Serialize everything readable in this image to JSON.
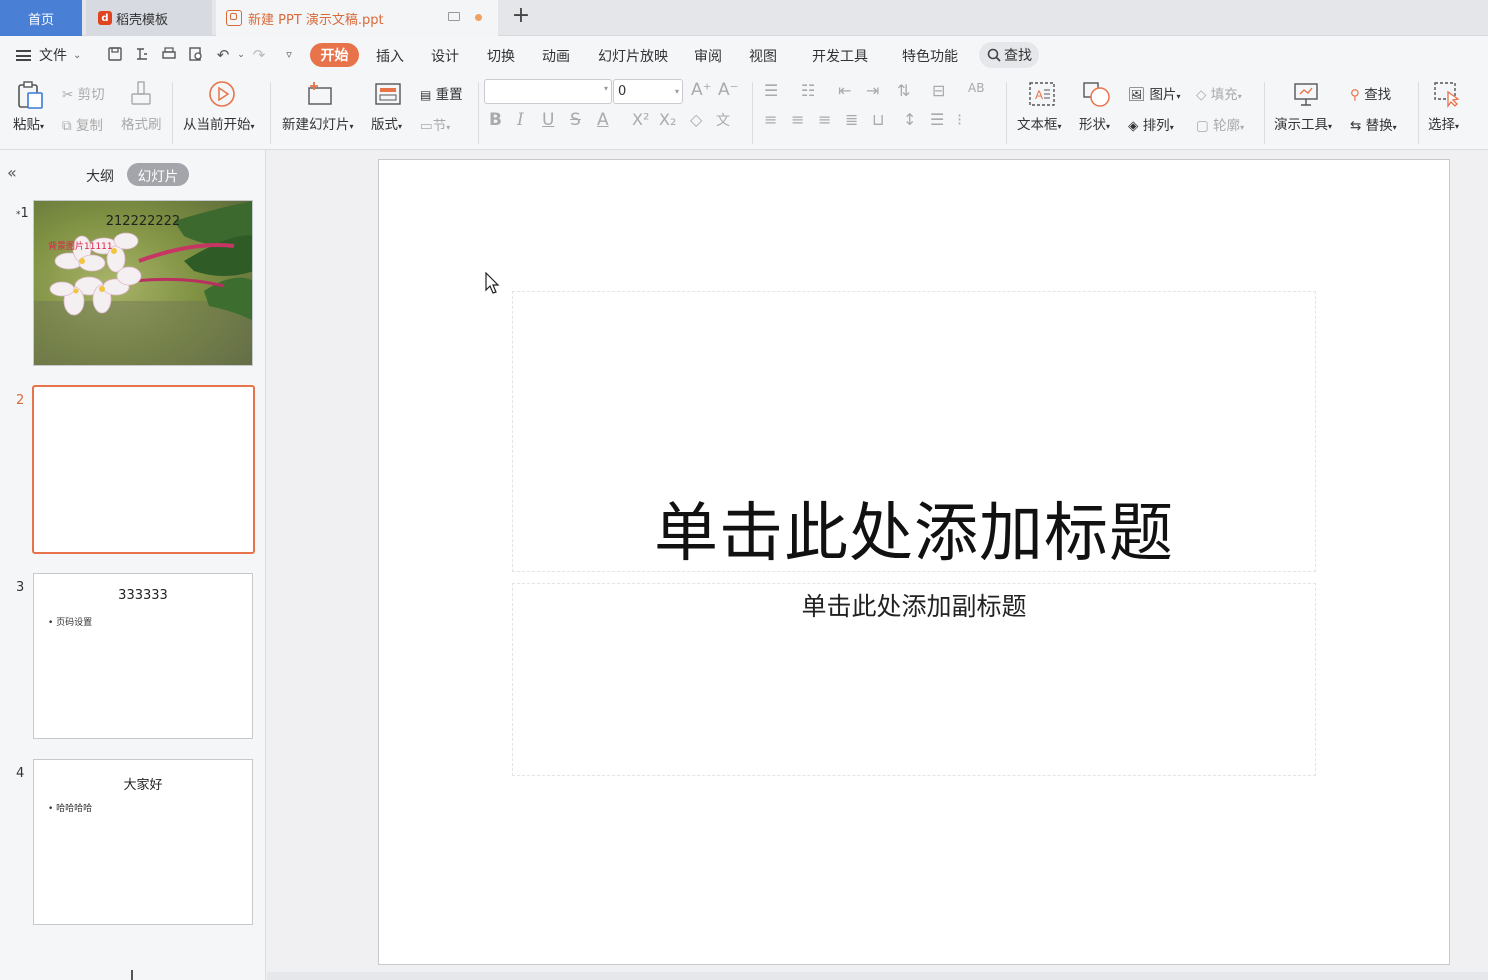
{
  "tabs": {
    "home": "首页",
    "template": "稻壳模板",
    "document": "新建 PPT 演示文稿.ppt"
  },
  "menu": {
    "file": "文件",
    "items": [
      "开始",
      "插入",
      "设计",
      "切换",
      "动画",
      "幻灯片放映",
      "审阅",
      "视图",
      "开发工具",
      "特色功能"
    ],
    "search": "查找"
  },
  "ribbon": {
    "paste": "粘贴",
    "cut": "剪切",
    "copy": "复制",
    "format_painter": "格式刷",
    "from_current": "从当前开始",
    "new_slide": "新建幻灯片",
    "layout": "版式",
    "reset": "重置",
    "section": "节",
    "font_name": "",
    "font_size": "0",
    "text_box": "文本框",
    "shape": "形状",
    "picture": "图片",
    "arrange": "排列",
    "fill": "填充",
    "outline": "轮廓",
    "presentation_tools": "演示工具",
    "find": "查找",
    "replace": "替换",
    "select": "选择"
  },
  "panel": {
    "outline_tab": "大纲",
    "slides_tab": "幻灯片"
  },
  "slides": [
    {
      "number": "1",
      "title": "212222222",
      "caption": "背景图片11111"
    },
    {
      "number": "2"
    },
    {
      "number": "3",
      "title": "333333",
      "bullet": "页码设置"
    },
    {
      "number": "4",
      "title": "大家好",
      "bullet": "哈哈哈哈"
    }
  ],
  "canvas": {
    "title_placeholder": "单击此处添加标题",
    "subtitle_placeholder": "单击此处添加副标题"
  },
  "colors": {
    "accent": "#e8734a",
    "home_tab": "#4a7fd6"
  }
}
